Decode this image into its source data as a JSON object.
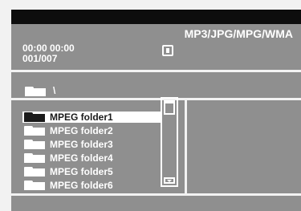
{
  "header": {
    "format_label": "MP3/JPG/MPG/WMA",
    "time_display": "00:00  00:00",
    "track_counter": "001/007"
  },
  "path": {
    "current_path": "\\"
  },
  "file_list": {
    "items": [
      {
        "label": "MPEG folder1",
        "selected": true
      },
      {
        "label": "MPEG folder2",
        "selected": false
      },
      {
        "label": "MPEG folder3",
        "selected": false
      },
      {
        "label": "MPEG folder4",
        "selected": false
      },
      {
        "label": "MPEG folder5",
        "selected": false
      },
      {
        "label": "MPEG folder6",
        "selected": false
      }
    ]
  },
  "icons": {
    "play_state": "stop-icon",
    "folder": "folder-icon"
  },
  "colors": {
    "panel": "#8f8f8f",
    "border": "#f2f2f2",
    "topbar": "#0d0d0d",
    "text": "#ffffff",
    "selection": "#ffffff"
  }
}
